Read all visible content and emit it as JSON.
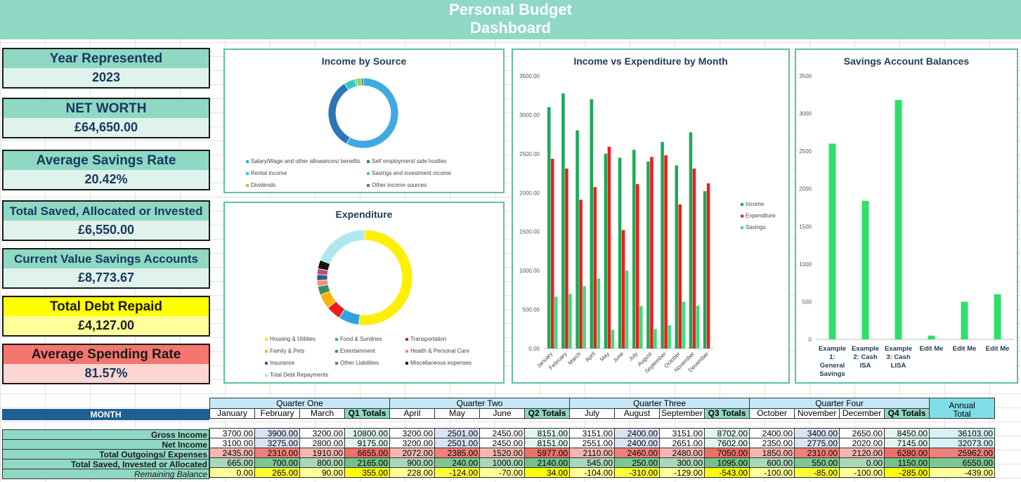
{
  "header": {
    "title_line1": "Personal Budget",
    "title_line2": "Dashboard"
  },
  "kpis": [
    {
      "label": "Year Represented",
      "value": "2023"
    },
    {
      "label": "NET WORTH",
      "value": "£64,650.00"
    },
    {
      "label": "Average Savings Rate",
      "value": "20.42%"
    },
    {
      "label": "Total Saved, Allocated or Invested",
      "value": "£6,550.00"
    },
    {
      "label": "Current Value Savings Accounts",
      "value": "£8,773.67"
    },
    {
      "label": "Total Debt Repaid",
      "value": "£4,127.00"
    },
    {
      "label": "Average Spending Rate",
      "value": "81.57%"
    }
  ],
  "income_chart": {
    "title": "Income by Source",
    "legend": [
      "Salary/Wage and other allowances/ benefits",
      "Self employment/ side hustles",
      "Rental income",
      "Savings and investment income",
      "Dividends",
      "Other income sources"
    ],
    "colors": [
      "#3fa9e0",
      "#2e75b6",
      "#33ccbb",
      "#3fc8a0",
      "#a4c94a",
      "#3b7fa6"
    ],
    "chart_data": {
      "type": "pie",
      "categories": [
        "Salary/Wage and other allowances/ benefits",
        "Self employment/ side hustles",
        "Rental income",
        "Savings and investment income",
        "Dividends",
        "Other income sources"
      ],
      "values": [
        58,
        33,
        5,
        1,
        2,
        1
      ]
    }
  },
  "expenditure_chart": {
    "title": "Expenditure",
    "legend": [
      "Housing & Utilities",
      "Food & Sundries",
      "Transportation",
      "Family & Pets",
      "Entertainment",
      "Health & Personal Care",
      "Insurance",
      "Other Liabilities",
      "Miscellaneous expenses",
      "Total Debt Repayments"
    ],
    "colors": [
      "#ffef00",
      "#2fa3e0",
      "#ee1c1c",
      "#f7b500",
      "#3d8b5e",
      "#f48c78",
      "#2d5d8c",
      "#c24d7a",
      "#111111",
      "#aee8ef"
    ],
    "chart_data": {
      "type": "pie",
      "categories": [
        "Housing & Utilities",
        "Food & Sundries",
        "Transportation",
        "Family & Pets",
        "Entertainment",
        "Health & Personal Care",
        "Insurance",
        "Other Liabilities",
        "Miscellaneous expenses",
        "Total Debt Repayments"
      ],
      "values": [
        52,
        7,
        5,
        5,
        3,
        2,
        2,
        2,
        3,
        19
      ]
    }
  },
  "monthly_chart": {
    "title": "Income vs Expenditure by Month",
    "chart_data": {
      "type": "bar",
      "categories": [
        "January",
        "February",
        "March",
        "April",
        "May",
        "June",
        "July",
        "August",
        "September",
        "October",
        "November",
        "December"
      ],
      "series": [
        {
          "name": "Income",
          "color": "#1aaa55",
          "values": [
            3100,
            3275,
            2800,
            3200,
            2501,
            2450,
            2551,
            2400,
            2651,
            2350,
            2775,
            2020
          ]
        },
        {
          "name": "Expenditure",
          "color": "#ee1c1c",
          "values": [
            2435,
            2310,
            1910,
            2072,
            2590,
            1520,
            2110,
            2460,
            2480,
            1850,
            2310,
            2120
          ]
        },
        {
          "name": "Savings",
          "color": "#33e07a",
          "values": [
            665,
            700,
            800,
            900,
            240,
            1000,
            545,
            250,
            300,
            600,
            550,
            0
          ]
        }
      ],
      "ylim": [
        0,
        3500
      ],
      "yticks": [
        "0.00",
        "500.00",
        "1000.00",
        "1500.00",
        "2000.00",
        "2500.00",
        "3000.00",
        "3500.00"
      ]
    }
  },
  "savings_chart": {
    "title": "Savings Account Balances",
    "chart_data": {
      "type": "bar",
      "categories": [
        "Example 1: General Savings",
        "Example 2: Cash ISA",
        "Example 3: Cash LISA",
        "Edit Me",
        "Edit Me",
        "Edit Me"
      ],
      "category_lines": [
        [
          "Example",
          "1:",
          "General",
          "Savings"
        ],
        [
          "Example",
          "2: Cash",
          "ISA"
        ],
        [
          "Example",
          "3: Cash",
          "LISA"
        ],
        [
          "Edit Me"
        ],
        [
          "Edit Me"
        ],
        [
          "Edit Me"
        ]
      ],
      "values": [
        2600,
        1840,
        3180,
        50,
        500,
        600
      ],
      "color": "#2ee06a",
      "ylim": [
        0,
        3500
      ],
      "yticks": [
        "0",
        "500",
        "1000",
        "1500",
        "2000",
        "2500",
        "3000",
        "3500"
      ]
    }
  },
  "table": {
    "month_label": "MONTH",
    "quarters": [
      "Quarter One",
      "Quarter Two",
      "Quarter Three",
      "Quarter Four"
    ],
    "annual_label": "Annual",
    "annual_sub": "Total",
    "columns": [
      [
        "January",
        "February",
        "March",
        "Q1 Totals"
      ],
      [
        "April",
        "May",
        "June",
        "Q2 Totals"
      ],
      [
        "July",
        "August",
        "September",
        "Q3 Totals"
      ],
      [
        "October",
        "November",
        "December",
        "Q4 Totals"
      ]
    ],
    "rows": [
      {
        "label": "Gross Income",
        "values": [
          "3700.00",
          "3900.00",
          "3200.00",
          "10800.00",
          "3200.00",
          "2501.00",
          "2450.00",
          "8151.00",
          "3151.00",
          "2400.00",
          "3151.00",
          "8702.00",
          "2400.00",
          "3400.00",
          "2650.00",
          "8450.00",
          "36103.00"
        ]
      },
      {
        "label": "Net Income",
        "values": [
          "3100.00",
          "3275.00",
          "2800.00",
          "9175.00",
          "3200.00",
          "2501.00",
          "2450.00",
          "8151.00",
          "2551.00",
          "2400.00",
          "2651.00",
          "7602.00",
          "2350.00",
          "2775.00",
          "2020.00",
          "7145.00",
          "32073.00"
        ]
      },
      {
        "label": "Total Outgoings/ Expenses",
        "values": [
          "2435.00",
          "2310.00",
          "1910.00",
          "6655.00",
          "2072.00",
          "2385.00",
          "1520.00",
          "5977.00",
          "2110.00",
          "2460.00",
          "2480.00",
          "7050.00",
          "1850.00",
          "2310.00",
          "2120.00",
          "6280.00",
          "25962.00"
        ]
      },
      {
        "label": "Total Saved, Invested or Allocated",
        "values": [
          "665.00",
          "700.00",
          "800.00",
          "2165.00",
          "900.00",
          "240.00",
          "1000.00",
          "2140.00",
          "545.00",
          "250.00",
          "300.00",
          "1095.00",
          "600.00",
          "550.00",
          "0.00",
          "1150.00",
          "6550.00"
        ]
      },
      {
        "label": "Remaining Balance",
        "values": [
          "0.00",
          "265.00",
          "90.00",
          "355.00",
          "228.00",
          "-124.00",
          "-70.00",
          "34.00",
          "-104.00",
          "-310.00",
          "-129.00",
          "-543.00",
          "-100.00",
          "-85.00",
          "-100.00",
          "-285.00",
          "-439.00"
        ]
      }
    ]
  }
}
